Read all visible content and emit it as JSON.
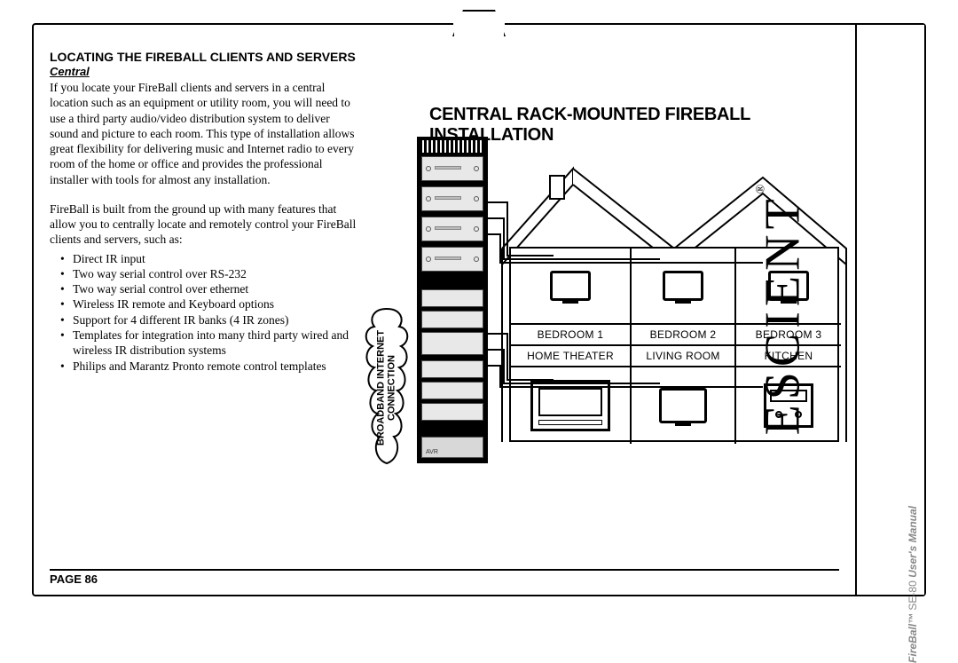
{
  "heading": "LOCATING THE FIREBALL CLIENTS AND SERVERS",
  "subhead": "Central",
  "para1": "If you locate your FireBall clients and servers in a central location such as an equipment or utility room, you will need to use a third party audio/video distribution system to deliver sound and picture to each room. This type of installation allows great flexibility for delivering music and Internet radio to every room of the home or office and provides the professional installer with tools for almost any installation.",
  "para2": "FireBall is built from the ground up with many features that allow you to centrally locate and remotely control your FireBall clients and servers, such as:",
  "features": [
    "Direct IR input",
    "Two way serial control over RS-232",
    "Two way serial control over ethernet",
    "Wireless IR remote and Keyboard options",
    "Support for 4 different IR banks (4 IR zones)",
    "Templates for integration into many third party wired and wireless IR distribution systems",
    "Philips and Marantz Pronto remote control templates"
  ],
  "footer": "PAGE 86",
  "brand": "ESCIENT",
  "reg": "®",
  "manual": {
    "fb": "FireBall™",
    "model": " SE-80 ",
    "um": "User's Manual"
  },
  "diagram": {
    "title": "CENTRAL RACK-MOUNTED FIREBALL INSTALLATION",
    "cloud_l1": "BROADBAND INTERNET",
    "cloud_l2": "CONNECTION",
    "rooms_top": [
      "BEDROOM 1",
      "BEDROOM 2",
      "BEDROOM 3"
    ],
    "rooms_bot": [
      "HOME THEATER",
      "LIVING ROOM",
      "KITCHEN"
    ]
  }
}
